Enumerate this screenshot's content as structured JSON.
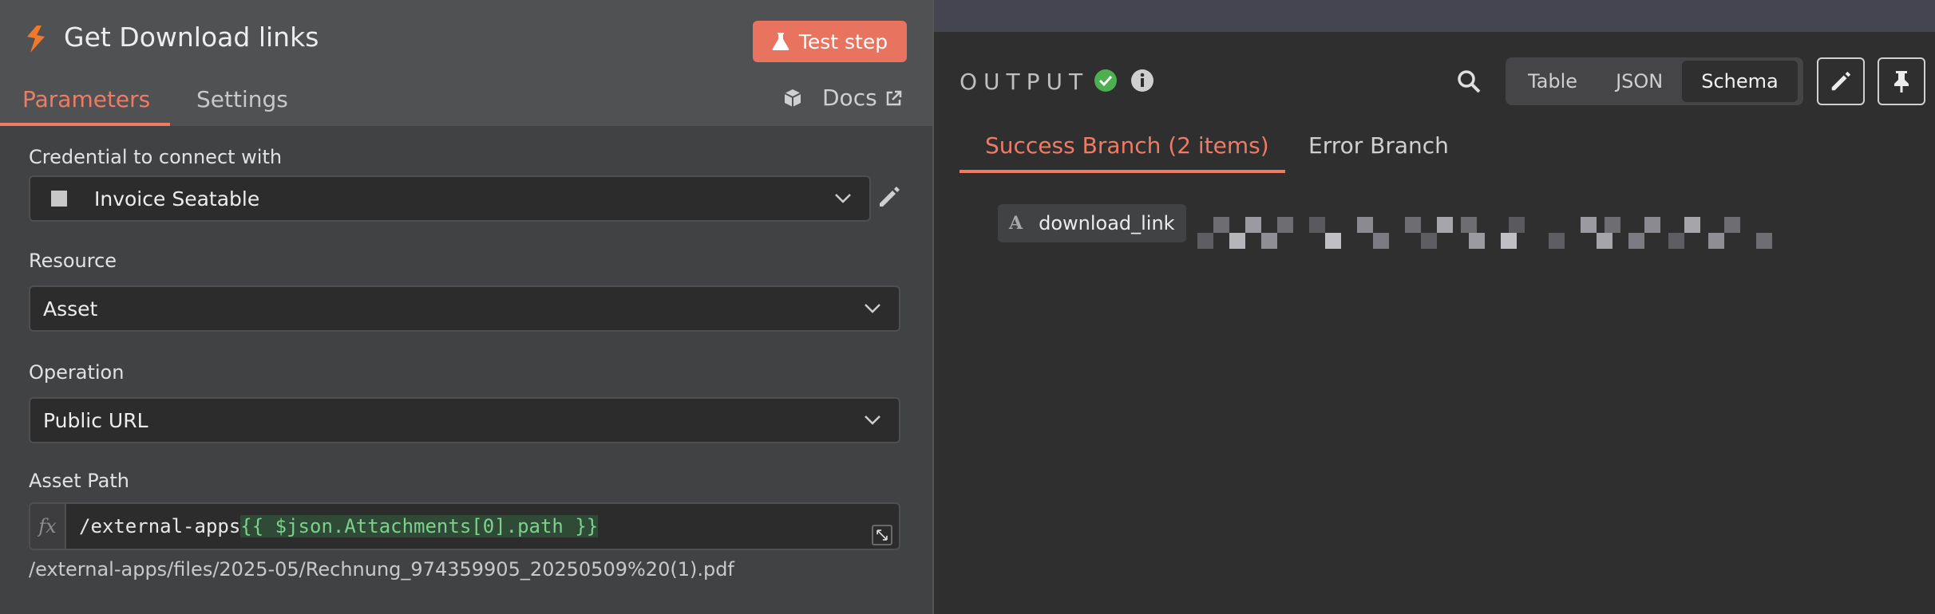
{
  "node": {
    "title": "Get Download links",
    "test_step_label": "Test step"
  },
  "tabs": {
    "parameters": "Parameters",
    "settings": "Settings",
    "docs": "Docs"
  },
  "credential": {
    "label": "Credential to connect with",
    "value": "Invoice Seatable"
  },
  "resource": {
    "label": "Resource",
    "value": "Asset"
  },
  "operation": {
    "label": "Operation",
    "value": "Public URL"
  },
  "asset_path": {
    "label": "Asset Path",
    "prefix": "/external-apps",
    "expression": "{{ $json.Attachments[0].path }}",
    "preview": "/external-apps/files/2025-05/Rechnung_974359905_20250509%20(1).pdf"
  },
  "output": {
    "label": "OUTPUT",
    "views": [
      "Table",
      "JSON",
      "Schema"
    ],
    "active_view": "Schema",
    "success_branch": "Success Branch (2 items)",
    "error_branch": "Error Branch",
    "schema_field": "download_link",
    "schema_type": "A"
  },
  "colors": {
    "accent": "#ee7c64",
    "success": "#4caf50",
    "expression_green": "#7fd08c"
  }
}
